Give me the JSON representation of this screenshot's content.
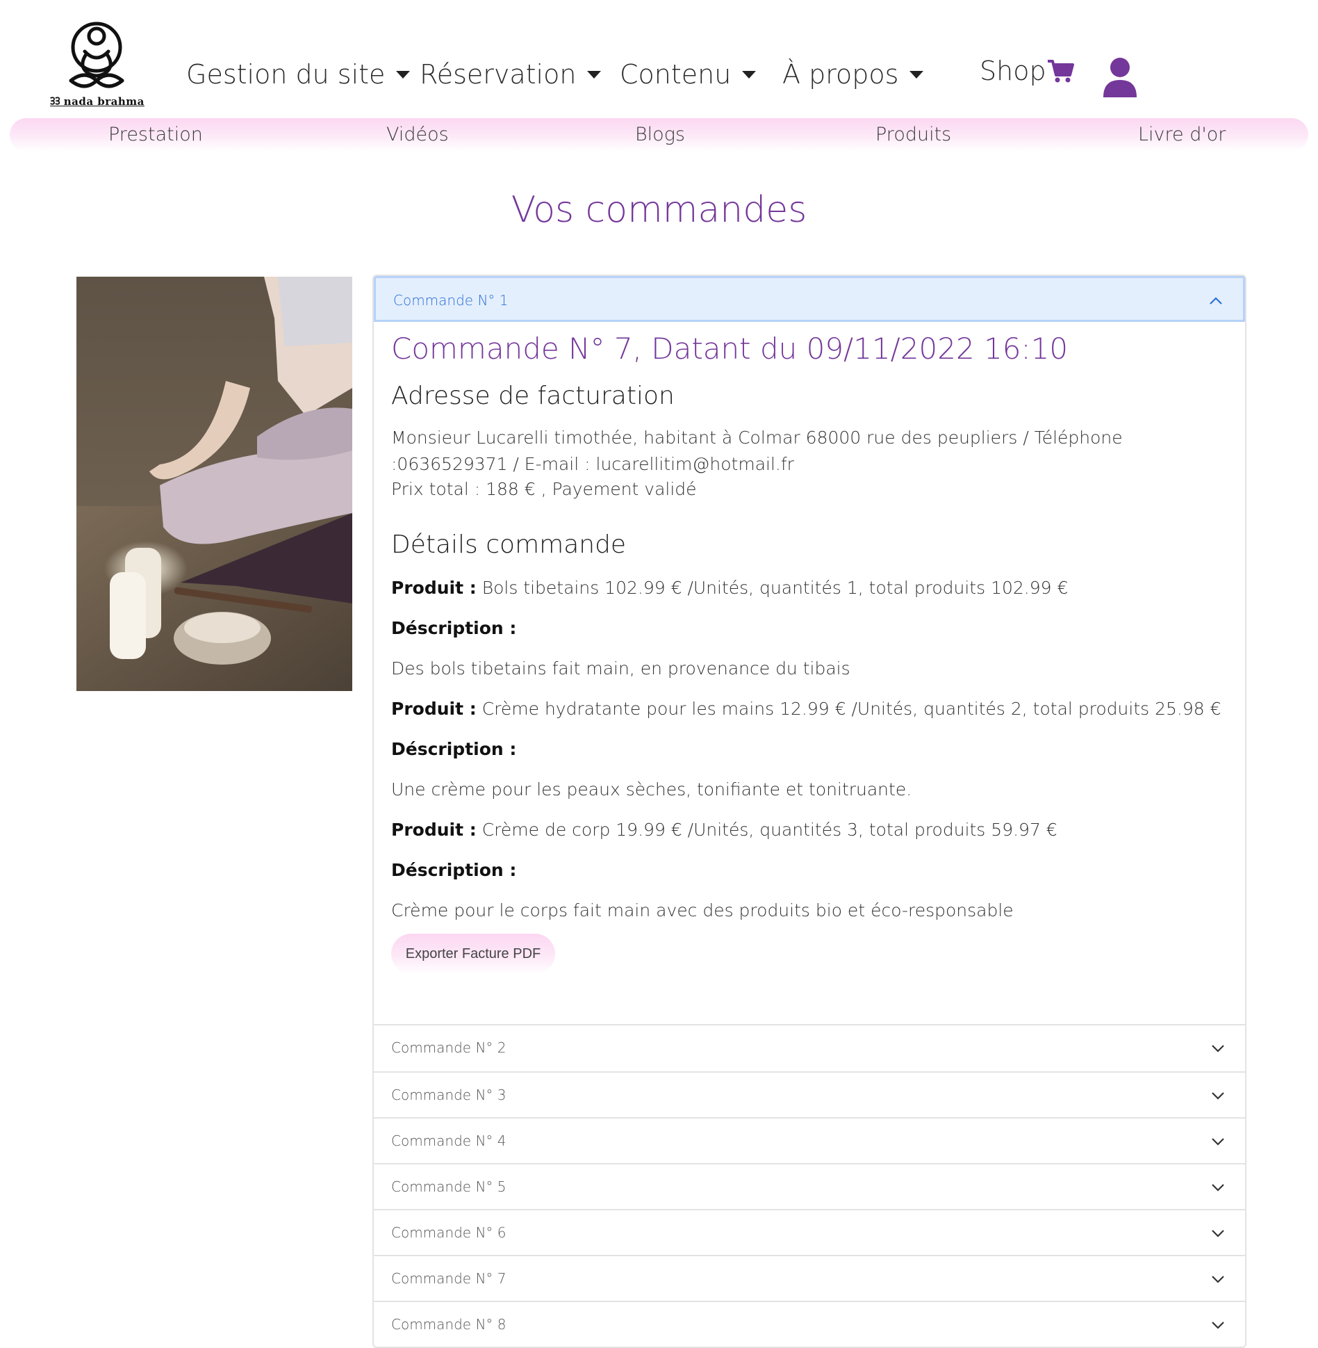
{
  "brand": {
    "logo_text": "ᢃᢃ nada brahma"
  },
  "nav": {
    "items": [
      {
        "label": "Gestion du site"
      },
      {
        "label": "Réservation"
      },
      {
        "label": "Contenu"
      },
      {
        "label": "À propos"
      }
    ],
    "shop_label": "Shop"
  },
  "subnav": {
    "items": [
      {
        "label": "Prestation"
      },
      {
        "label": "Vidéos"
      },
      {
        "label": "Blogs"
      },
      {
        "label": "Produits"
      },
      {
        "label": "Livre d'or"
      }
    ]
  },
  "page": {
    "title": "Vos commandes"
  },
  "orders": {
    "open": {
      "header": "Commande N° 1",
      "title": "Commande N° 7, Datant du 09/11/2022 16:10",
      "billing_heading": "Adresse de facturation",
      "address": "Monsieur Lucarelli timothée, habitant à Colmar 68000 rue des peupliers / Téléphone :0636529371 / E-mail : lucarellitim@hotmail.fr",
      "total": "Prix total : 188 € , Payement validé",
      "details_heading": "Détails commande",
      "product_label": "Produit :",
      "description_label": "Déscription :",
      "products": [
        {
          "summary": "Bols tibetains 102.99 € /Unités, quantités 1, total produits 102.99 €",
          "description": "Des bols tibetains fait main, en provenance du tibais"
        },
        {
          "summary": "Crème hydratante pour les mains 12.99 € /Unités, quantités 2, total produits 25.98 €",
          "description": "Une crème pour les peaux sèches, tonifiante et tonitruante."
        },
        {
          "summary": "Crème de corp 19.99 € /Unités, quantités 3, total produits 59.97 €",
          "description": "Crème pour le corps fait main avec des produits bio et éco-responsable"
        }
      ],
      "export_label": "Exporter Facture PDF"
    },
    "collapsed": [
      {
        "label": "Commande N° 2"
      },
      {
        "label": "Commande N° 3"
      },
      {
        "label": "Commande N° 4"
      },
      {
        "label": "Commande N° 5"
      },
      {
        "label": "Commande N° 6"
      },
      {
        "label": "Commande N° 7"
      },
      {
        "label": "Commande N° 8"
      }
    ]
  },
  "colors": {
    "accent_purple": "#74379a",
    "nav_pink": "#fbd7f1",
    "accordion_active_bg": "#e4effd",
    "accordion_active_text": "#2b6fd6"
  },
  "icons": {
    "nav_caret": "caret-down-icon",
    "shop": "cart-icon",
    "account": "user-icon",
    "open_chevron": "chevron-up-icon",
    "row_chevron": "chevron-down-icon"
  }
}
